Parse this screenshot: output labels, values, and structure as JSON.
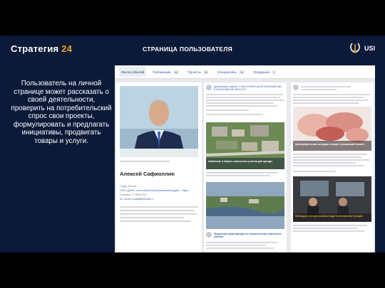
{
  "slide": {
    "title_main": "Стратегия",
    "title_accent": "24",
    "heading": "СТРАНИЦА ПОЛЬЗОВАТЕЛЯ",
    "logo_text": "USI",
    "body": "Пользователь на личной странице может рассказать о своей деятельности, проверить на потребительский спрос свои проекты, формулировать и предлагать инициативы, продвигать товары и услуги."
  },
  "screenshot": {
    "tabs": [
      {
        "label": "Лента событий",
        "count": ""
      },
      {
        "label": "Публикации",
        "count": "44"
      },
      {
        "label": "Проекты",
        "count": "33"
      },
      {
        "label": "Инициативы",
        "count": "34"
      },
      {
        "label": "Продукция",
        "count": "2"
      }
    ],
    "profile": {
      "name": "Алексей Сафиоллин",
      "lines": [
        "Город: Россия",
        "ООО «ДОН», член областной региональной думы – Муро",
        "телефон: +7 9000 XXX",
        "эл. почта: a.safiollin@mail.ru"
      ]
    },
    "feed_mid": {
      "post1_title": "Дополнение к закону \"О ЛЬГОТНОМ НАЛОГООБЛОЖЕНИИ В МОСКОВСКОЙ ОБЛАСТИ\"",
      "image1_caption": "Заявление в общего земельного участка для аренды",
      "image2_caption": "Продление срока аренды по строительству земельного участка"
    },
    "feed_right": {
      "image1_caption": "Демографическая ситуация отводит в решающий момент",
      "image2_caption": "Жилищные ресурсы вновь ведут в восприятие позиции"
    },
    "colors": {
      "slide_bg": "#0b1a38",
      "accent": "#f2a21b",
      "link": "#2b62a8"
    }
  }
}
